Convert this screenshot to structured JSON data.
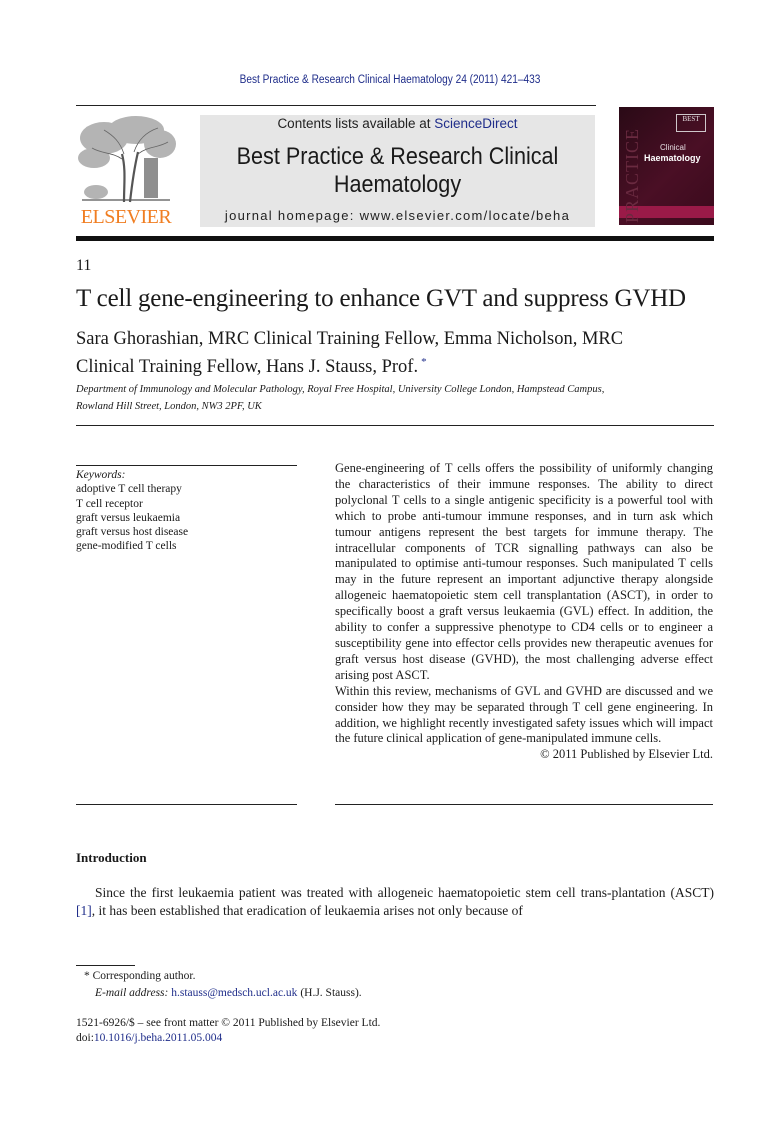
{
  "running_header": "Best Practice & Research Clinical Haematology 24 (2011) 421–433",
  "publisher_logo": {
    "name": "ELSEVIER",
    "icon": "elsevier-tree-icon",
    "color": "#f07e22"
  },
  "banner": {
    "contents_prefix": "Contents lists available at ",
    "contents_link": "ScienceDirect",
    "journal_title_line1": "Best Practice & Research Clinical",
    "journal_title_line2": "Haematology",
    "homepage": "journal homepage: www.elsevier.com/locate/beha"
  },
  "cover": {
    "best_label": "BEST",
    "clinical": "Clinical",
    "haematology": "Haematology",
    "practice": "PRACTICE",
    "colors": {
      "background": "#3a0a1c",
      "band": "#9a1a48"
    }
  },
  "article": {
    "chapter_number": "11",
    "title": "T cell gene-engineering to enhance GVT and suppress GVHD",
    "authors_line1": "Sara Ghorashian, MRC Clinical Training Fellow, Emma Nicholson, MRC",
    "authors_line2": "Clinical Training Fellow, Hans J. Stauss, Prof.",
    "corresponding_marker": "*",
    "affiliation_line1": "Department of Immunology and Molecular Pathology, Royal Free Hospital, University College London, Hampstead Campus,",
    "affiliation_line2": "Rowland Hill Street, London, NW3 2PF, UK"
  },
  "keywords": {
    "label": "Keywords:",
    "items": [
      "adoptive T cell therapy",
      "T cell receptor",
      "graft versus leukaemia",
      "graft versus host disease",
      "gene-modified T cells"
    ]
  },
  "abstract": {
    "paragraph1": "Gene-engineering of T cells offers the possibility of uniformly changing the characteristics of their immune responses. The ability to direct polyclonal T cells to a single antigenic specificity is a powerful tool with which to probe anti-tumour immune responses, and in turn ask which tumour antigens represent the best targets for immune therapy. The intracellular components of TCR signalling pathways can also be manipulated to optimise anti-tumour responses. Such manipulated T cells may in the future represent an important adjunctive therapy alongside allogeneic haematopoietic stem cell transplantation (ASCT), in order to specifically boost a graft versus leukaemia (GVL) effect. In addition, the ability to confer a suppressive phenotype to CD4 cells or to engineer a susceptibility gene into effector cells provides new therapeutic avenues for graft versus host disease (GVHD), the most challenging adverse effect arising post ASCT.",
    "paragraph2": "Within this review, mechanisms of GVL and GVHD are discussed and we consider how they may be separated through T cell gene engineering. In addition, we highlight recently investigated safety issues which will impact the future clinical application of gene-manipulated immune cells.",
    "copyright": "© 2011 Published by Elsevier Ltd."
  },
  "introduction": {
    "heading": "Introduction",
    "text_before_ref": "Since the first leukaemia patient was treated with allogeneic haematopoietic stem cell trans-plantation (ASCT) ",
    "reference": "[1]",
    "text_after_ref": ", it has been established that eradication of leukaemia arises not only because of"
  },
  "footnotes": {
    "marker": "*",
    "corresponding": "Corresponding author.",
    "email_label": "E-mail address:",
    "email": "h.stauss@medsch.ucl.ac.uk",
    "email_owner": "(H.J. Stauss).",
    "front_matter": "1521-6926/$ – see front matter © 2011 Published by Elsevier Ltd.",
    "doi_prefix": "doi:",
    "doi": "10.1016/j.beha.2011.05.004"
  },
  "colors": {
    "link": "#1f2d8a",
    "elsevier_orange": "#f07e22",
    "banner_bg": "#e6e6e6"
  }
}
